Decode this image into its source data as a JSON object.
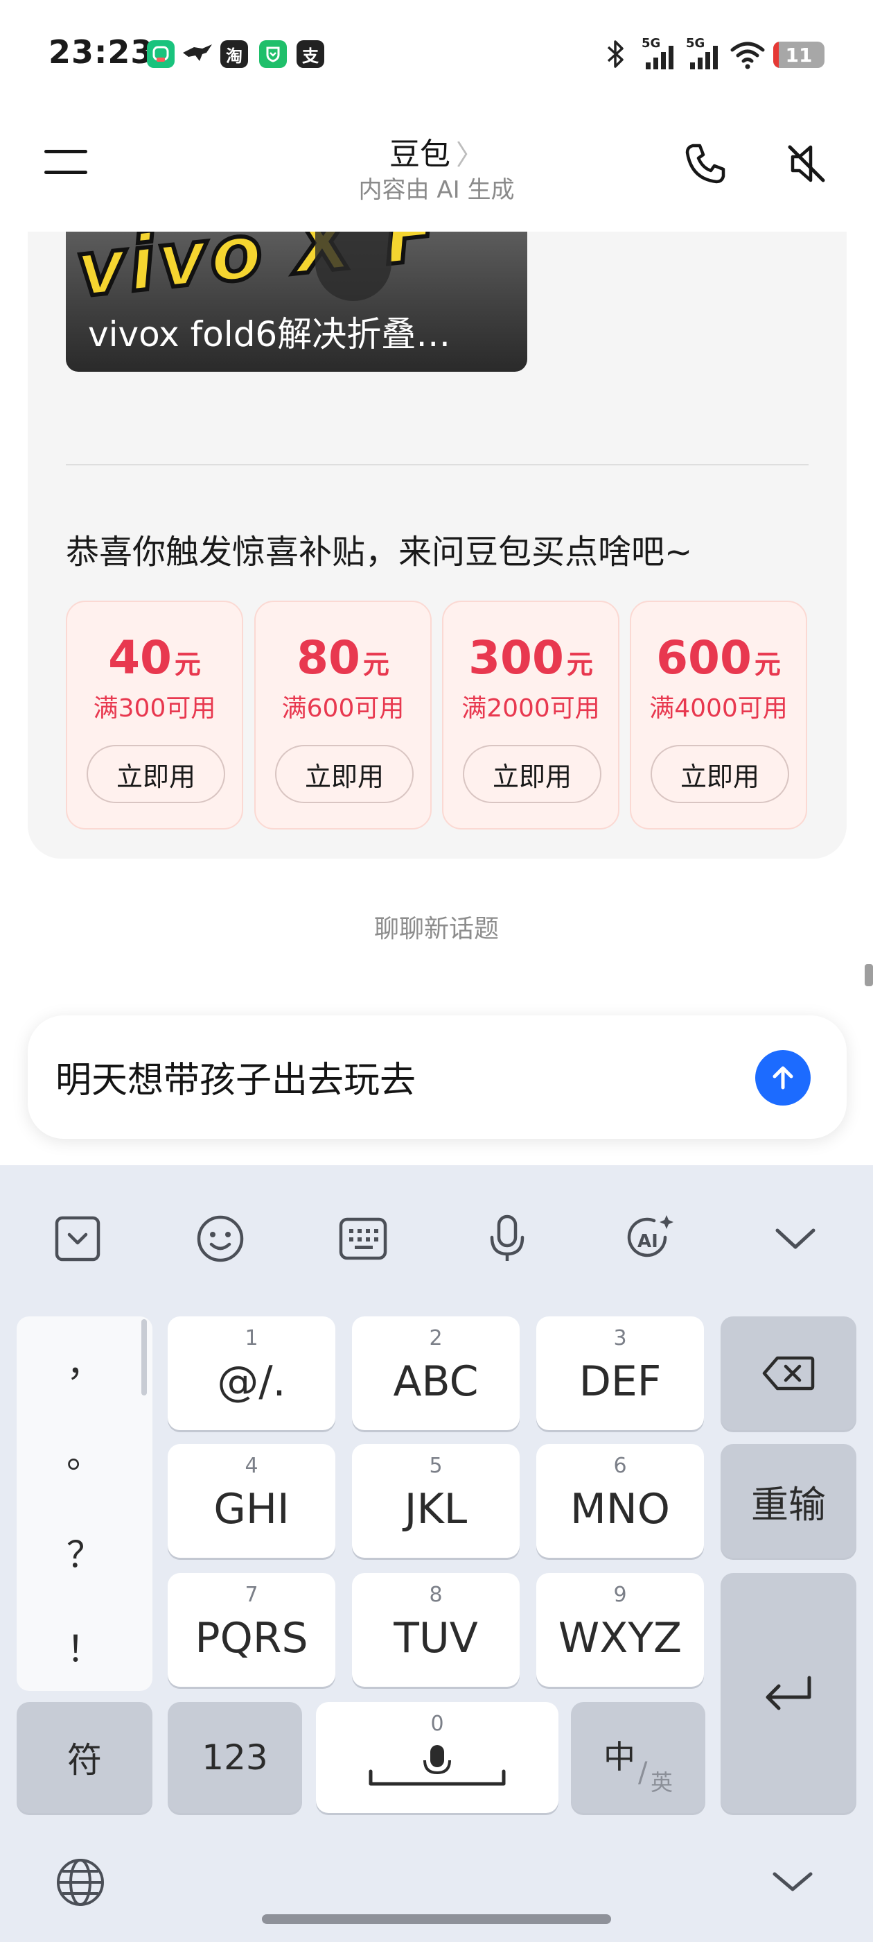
{
  "status_bar": {
    "time": "23:23",
    "notification_icons": [
      "app-icon",
      "bird-icon",
      "taobao-icon",
      "shield-app-icon",
      "alipay-icon"
    ],
    "taobao_char": "淘",
    "alipay_char": "支",
    "signal_1": "5G",
    "signal_2": "5G",
    "battery_level": "11"
  },
  "header": {
    "title": "豆包",
    "title_chevron": "〉",
    "subtitle": "内容由 AI 生成"
  },
  "chat": {
    "video_caption": "vivox fold6解决折叠…",
    "promo_text": "恭喜你触发惊喜补贴，来问豆包买点啥吧~",
    "coupons": [
      {
        "amount": "40",
        "unit": "元",
        "condition": "满300可用",
        "button": "立即用"
      },
      {
        "amount": "80",
        "unit": "元",
        "condition": "满600可用",
        "button": "立即用"
      },
      {
        "amount": "300",
        "unit": "元",
        "condition": "满2000可用",
        "button": "立即用"
      },
      {
        "amount": "600",
        "unit": "元",
        "condition": "满4000可用",
        "button": "立即用"
      }
    ],
    "new_topic": "聊聊新话题"
  },
  "input": {
    "value": "明天想带孩子出去玩去"
  },
  "keyboard": {
    "punct": [
      "，",
      "。",
      "？",
      "！"
    ],
    "keys": [
      {
        "digit": "1",
        "letters": "@/."
      },
      {
        "digit": "2",
        "letters": "ABC"
      },
      {
        "digit": "3",
        "letters": "DEF"
      },
      {
        "digit": "4",
        "letters": "GHI"
      },
      {
        "digit": "5",
        "letters": "JKL"
      },
      {
        "digit": "6",
        "letters": "MNO"
      },
      {
        "digit": "7",
        "letters": "PQRS"
      },
      {
        "digit": "8",
        "letters": "TUV"
      },
      {
        "digit": "9",
        "letters": "WXYZ"
      }
    ],
    "reenter": "重输",
    "symbols": "符",
    "numbers": "123",
    "space_digit": "0",
    "lang_main": "中",
    "lang_sub": "英"
  },
  "colors": {
    "accent_blue": "#1c6bff",
    "coupon_red": "#e8384f",
    "coupon_bg": "#fff1ee",
    "keyboard_bg": "#e7ebf3"
  }
}
